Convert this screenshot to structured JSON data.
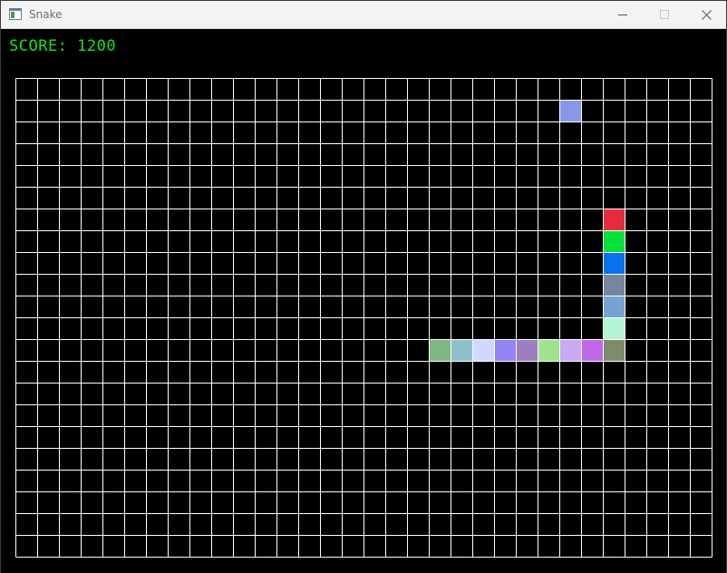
{
  "window": {
    "title": "Snake"
  },
  "score": {
    "text": "SCORE: 1200"
  },
  "colors": {
    "background": "#000000",
    "grid_line": "#ffffff",
    "score_text": "#18e51a",
    "food": "#8898e8"
  },
  "board": {
    "cols": 32,
    "rows": 22
  },
  "food": {
    "col": 25,
    "row": 1
  },
  "snake": [
    {
      "col": 27,
      "row": 6,
      "color": "#e52b3c"
    },
    {
      "col": 27,
      "row": 7,
      "color": "#06e03a"
    },
    {
      "col": 27,
      "row": 8,
      "color": "#0a72ef"
    },
    {
      "col": 27,
      "row": 9,
      "color": "#7585a2"
    },
    {
      "col": 27,
      "row": 10,
      "color": "#77a2d3"
    },
    {
      "col": 27,
      "row": 11,
      "color": "#b4f3d3"
    },
    {
      "col": 27,
      "row": 12,
      "color": "#7e8c6c"
    },
    {
      "col": 26,
      "row": 12,
      "color": "#be6ae6"
    },
    {
      "col": 25,
      "row": 12,
      "color": "#cba8f2"
    },
    {
      "col": 24,
      "row": 12,
      "color": "#9fe38f"
    },
    {
      "col": 23,
      "row": 12,
      "color": "#9e7ebf"
    },
    {
      "col": 22,
      "row": 12,
      "color": "#9284f2"
    },
    {
      "col": 21,
      "row": 12,
      "color": "#cedaff"
    },
    {
      "col": 20,
      "row": 12,
      "color": "#8cc1cb"
    },
    {
      "col": 19,
      "row": 12,
      "color": "#81b681"
    }
  ],
  "icons": {
    "app": "app-window-icon",
    "minimize": "minimize-icon",
    "maximize": "maximize-icon",
    "close": "close-icon"
  }
}
